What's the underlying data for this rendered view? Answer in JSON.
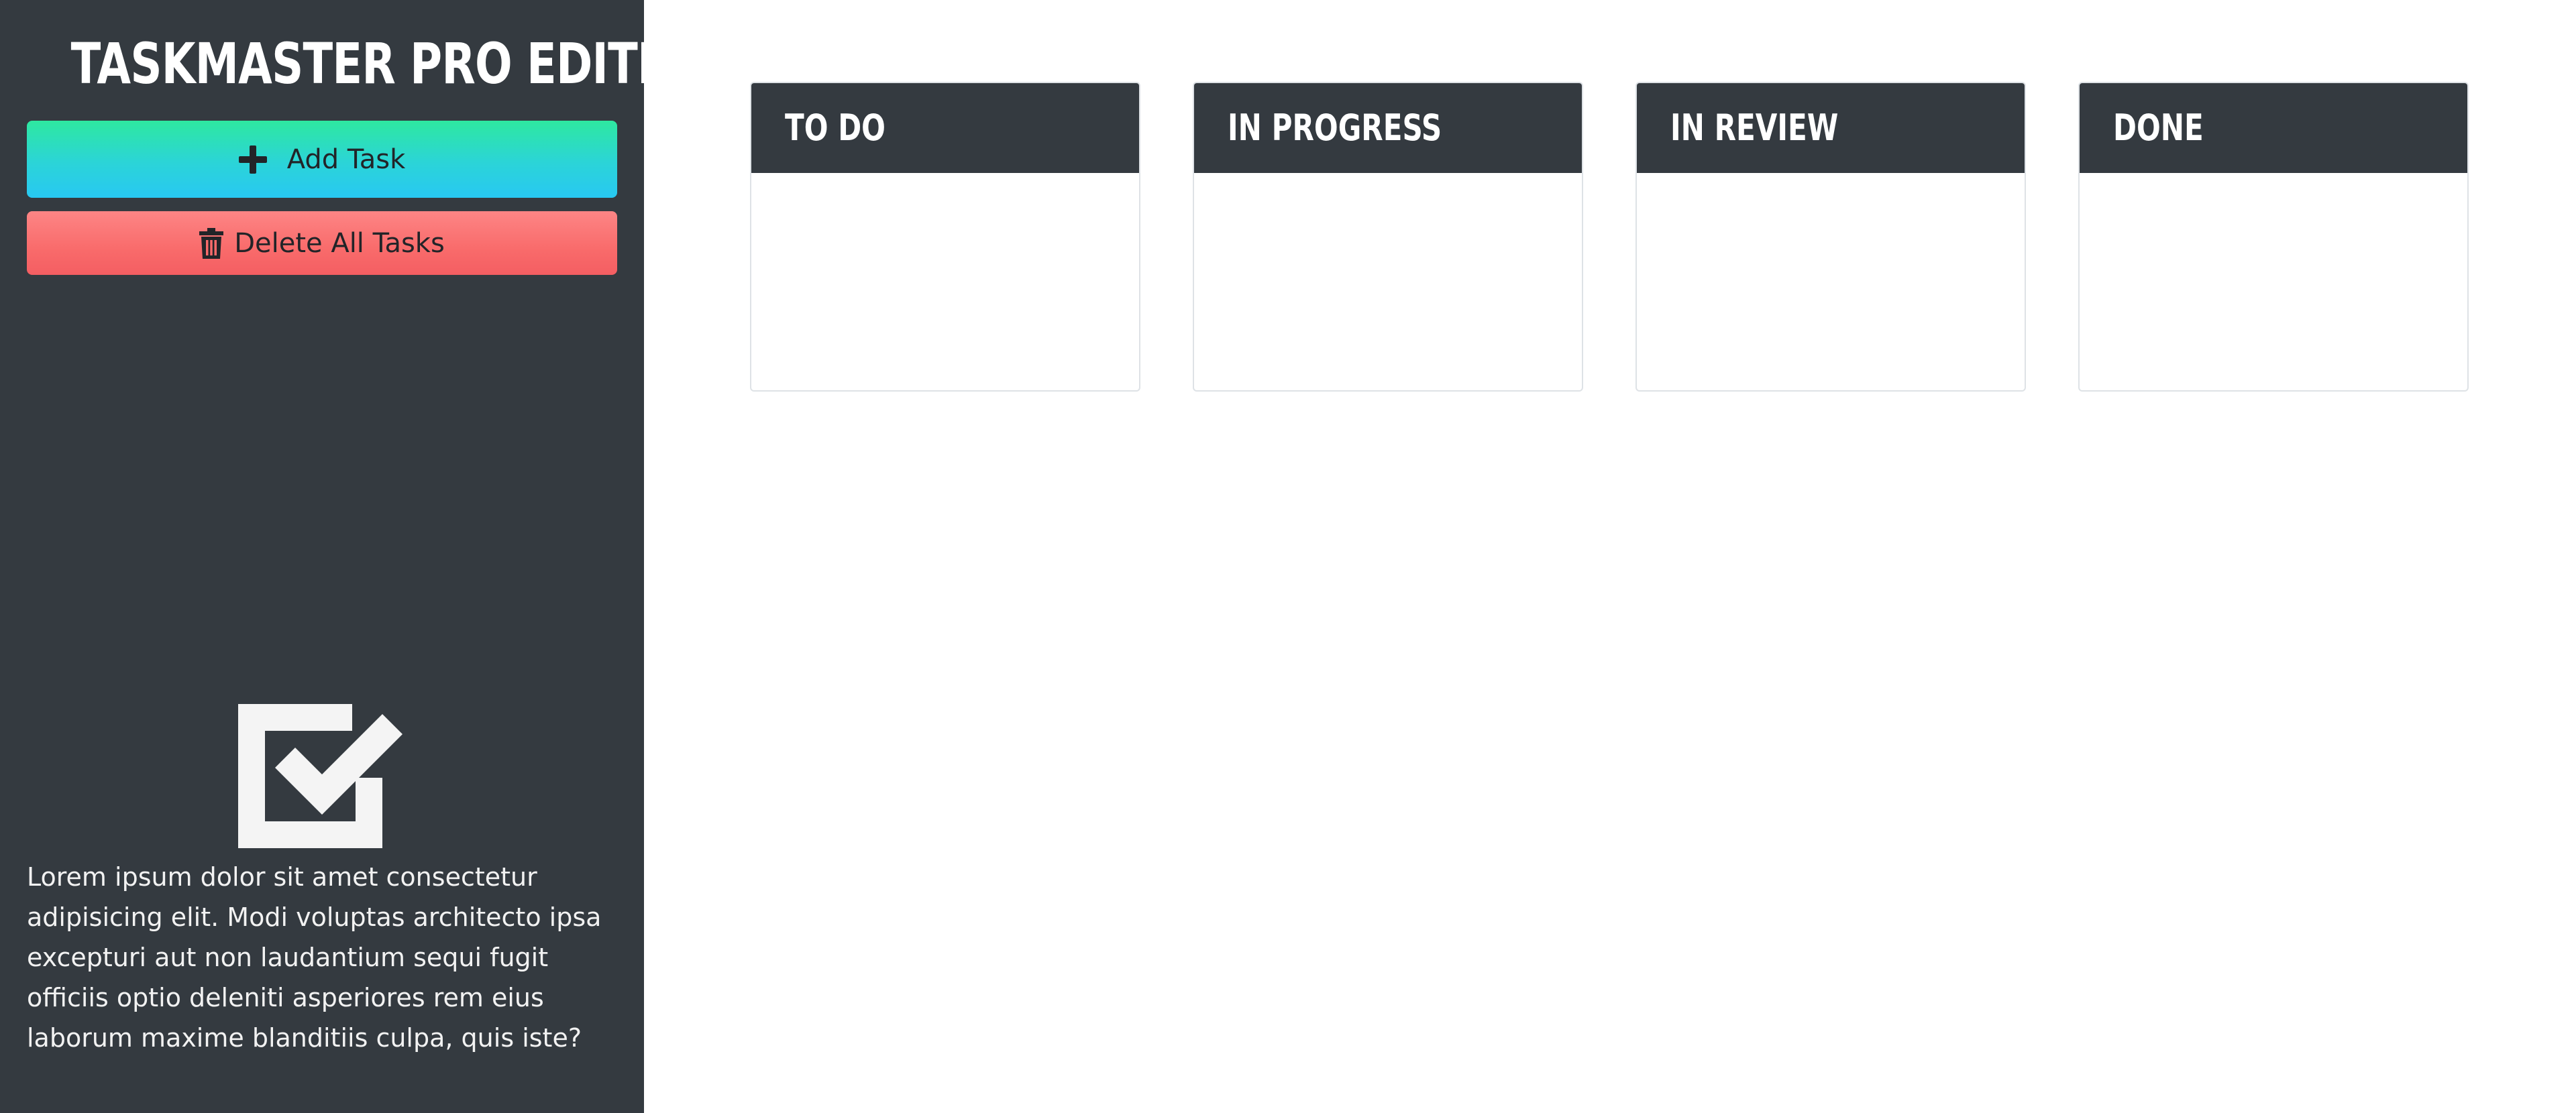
{
  "sidebar": {
    "title": "TASKMASTER PRO EDITION",
    "add_button_label": "Add Task",
    "delete_button_label": "Delete All Tasks",
    "description": "Lorem ipsum dolor sit amet consectetur adipisicing elit. Modi voluptas architecto ipsa excepturi aut non laudantium sequi fugit officiis optio deleniti asperiores rem eius laborum maxime blanditiis culpa, quis iste?",
    "icons": {
      "add": "plus-icon",
      "delete": "trash-icon",
      "logo": "checkbox-check-icon"
    }
  },
  "board": {
    "columns": [
      {
        "title": "TO DO",
        "tasks": []
      },
      {
        "title": "IN PROGRESS",
        "tasks": []
      },
      {
        "title": "IN REVIEW",
        "tasks": []
      },
      {
        "title": "DONE",
        "tasks": []
      }
    ]
  },
  "colors": {
    "sidebar_background": "#343a40",
    "header_background": "#343a40",
    "add_button_gradient": [
      "#2ee8a0",
      "#28c8f2"
    ],
    "delete_button_gradient": [
      "#fd8585",
      "#f45e62"
    ],
    "column_border": "#dee2e6"
  }
}
